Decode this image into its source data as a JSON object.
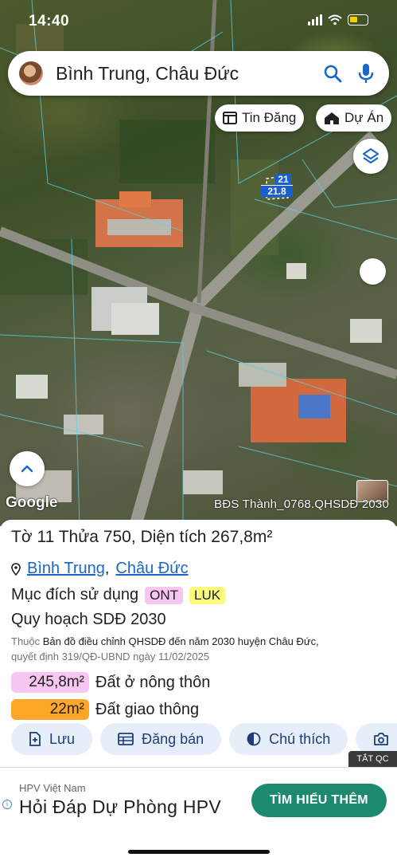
{
  "status": {
    "time": "14:40"
  },
  "search": {
    "text": "Bình Trung, Châu Đức"
  },
  "chips": {
    "news_label": "Tin Đăng",
    "project_label": "Dự Án"
  },
  "map": {
    "parcel_number": "21",
    "parcel_area": "21.8",
    "google_label": "Google",
    "watermark": "BĐS Thành_0768.QHSDĐ 2030"
  },
  "parcel": {
    "sheet_label": "Tờ",
    "sheet": "11",
    "plot_label": "Thửa",
    "plot": "750",
    "area_label": "Diện tích",
    "area": "267,8m²",
    "ward": "Bình Trung",
    "district": "Châu Đức",
    "purpose_label": "Mục đích sử dụng",
    "purpose_codes": [
      "ONT",
      "LUK"
    ],
    "plan_title": "Quy hoạch SDĐ 2030",
    "source_prefix": "Thuộc",
    "source_doc": "Bản đồ điều chỉnh QHSDĐ đến năm 2030 huyện Châu Đức,",
    "source_decision": "quyết định 319/QĐ-UBND ngày 11/02/2025",
    "land_uses": [
      {
        "area": "245,8m²",
        "name": "Đất ở nông thôn",
        "color": "#f8c6f2"
      },
      {
        "area": "22m²",
        "name": "Đất giao thông",
        "color": "#fca627"
      }
    ]
  },
  "actions": {
    "save": "Lưu",
    "post_sale": "Đăng bán",
    "legend": "Chú thích",
    "camera_partial": "C"
  },
  "ad": {
    "close_label": "TẮT QC",
    "sponsor": "HPV Việt Nam",
    "headline": "Hỏi Đáp Dự Phòng HPV",
    "cta": "TÌM HIỂU THÊM",
    "cta_color": "#1b8a6e"
  },
  "colors": {
    "link": "#1a66c9",
    "parcel_label_bg": "#1a5fd0",
    "action_bg": "#e6eefa"
  }
}
